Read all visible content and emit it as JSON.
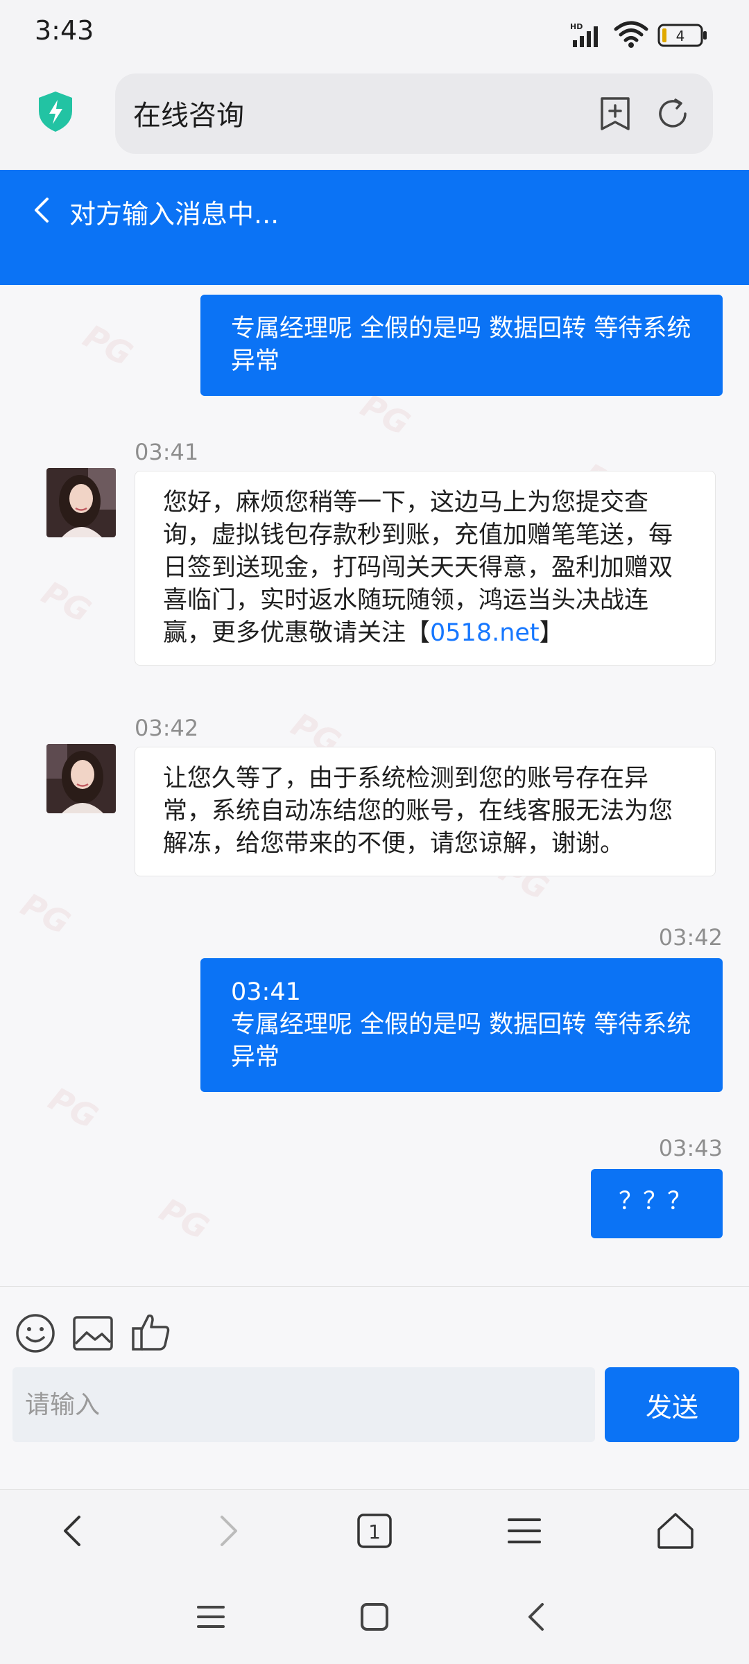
{
  "status_bar": {
    "time": "3:43",
    "network": "HD",
    "battery": "4"
  },
  "browser": {
    "page_title": "在线咨询",
    "tab_count": "1"
  },
  "chat_header": {
    "status": "对方输入消息中..."
  },
  "messages": [
    {
      "type": "out",
      "text": "专属经理呢 全假的是吗 数据回转 等待系统异常"
    },
    {
      "type": "in",
      "time": "03:41",
      "text": "您好，麻烦您稍等一下，这边马上为您提交查询，虚拟钱包存款秒到账，充值加赠笔笔送，每日签到送现金，打码闯关天天得意，盈利加赠双喜临门，实时返水随玩随领，鸿运当头决战连赢，更多优惠敬请关注【",
      "link": "0518.net",
      "text_end": "】"
    },
    {
      "type": "in",
      "time": "03:42",
      "text": "让您久等了，由于系统检测到您的账号存在异常，系统自动冻结您的账号，在线客服无法为您解冻，给您带来的不便，请您谅解，谢谢。"
    },
    {
      "type": "out",
      "time": "03:42",
      "quoted_time": "03:41",
      "text": "专属经理呢 全假的是吗 数据回转 等待系统异常"
    },
    {
      "type": "out",
      "time": "03:43",
      "text": "？？？"
    }
  ],
  "input": {
    "placeholder": "请输入",
    "send_label": "发送"
  },
  "watermark": "PG",
  "colors": {
    "accent": "#0b73f5",
    "shield": "#22c3a3"
  }
}
